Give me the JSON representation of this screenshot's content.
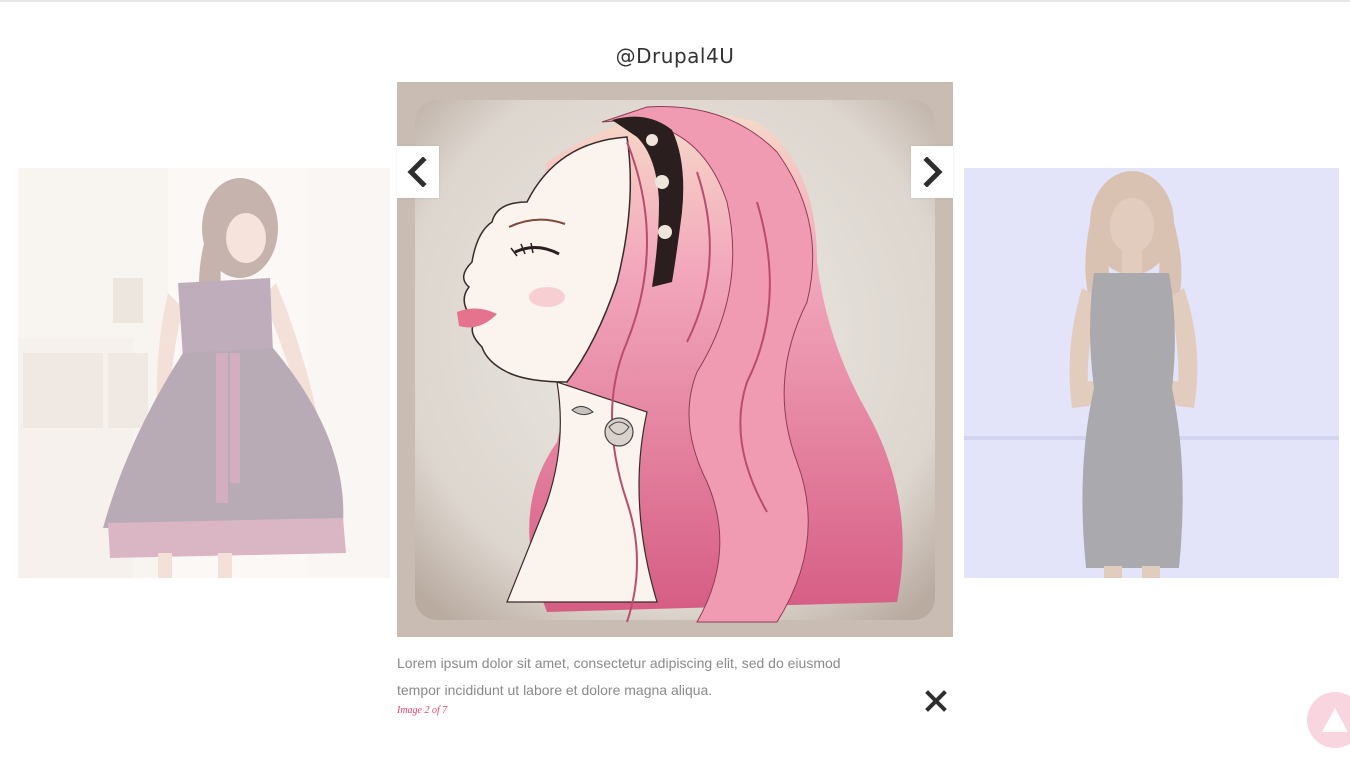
{
  "lightbox": {
    "title": "@Drupal4U",
    "caption": "Lorem ipsum dolor sit amet, consectetur adipiscing elit, sed do eiusmod tempor incididunt ut labore et dolore magna aliqua.",
    "counter": "Image 2 of 7"
  },
  "icons": {
    "prev": "chevron-left-icon",
    "next": "chevron-right-icon",
    "close": "close-icon",
    "scroll_top": "arrow-up-icon"
  },
  "colors": {
    "accent": "#e34466",
    "scroll_top_bg": "#f9d6df",
    "caption_text": "#8a8a8a"
  }
}
